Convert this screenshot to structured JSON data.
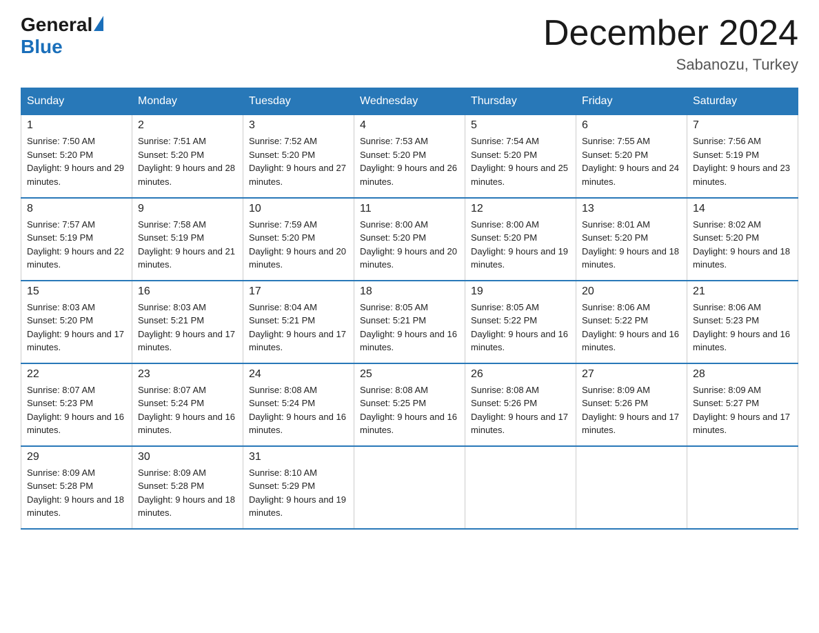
{
  "header": {
    "logo_general": "General",
    "logo_blue": "Blue",
    "title": "December 2024",
    "subtitle": "Sabanozu, Turkey"
  },
  "days_of_week": [
    "Sunday",
    "Monday",
    "Tuesday",
    "Wednesday",
    "Thursday",
    "Friday",
    "Saturday"
  ],
  "weeks": [
    [
      {
        "day": "1",
        "sunrise": "7:50 AM",
        "sunset": "5:20 PM",
        "daylight": "9 hours and 29 minutes."
      },
      {
        "day": "2",
        "sunrise": "7:51 AM",
        "sunset": "5:20 PM",
        "daylight": "9 hours and 28 minutes."
      },
      {
        "day": "3",
        "sunrise": "7:52 AM",
        "sunset": "5:20 PM",
        "daylight": "9 hours and 27 minutes."
      },
      {
        "day": "4",
        "sunrise": "7:53 AM",
        "sunset": "5:20 PM",
        "daylight": "9 hours and 26 minutes."
      },
      {
        "day": "5",
        "sunrise": "7:54 AM",
        "sunset": "5:20 PM",
        "daylight": "9 hours and 25 minutes."
      },
      {
        "day": "6",
        "sunrise": "7:55 AM",
        "sunset": "5:20 PM",
        "daylight": "9 hours and 24 minutes."
      },
      {
        "day": "7",
        "sunrise": "7:56 AM",
        "sunset": "5:19 PM",
        "daylight": "9 hours and 23 minutes."
      }
    ],
    [
      {
        "day": "8",
        "sunrise": "7:57 AM",
        "sunset": "5:19 PM",
        "daylight": "9 hours and 22 minutes."
      },
      {
        "day": "9",
        "sunrise": "7:58 AM",
        "sunset": "5:19 PM",
        "daylight": "9 hours and 21 minutes."
      },
      {
        "day": "10",
        "sunrise": "7:59 AM",
        "sunset": "5:20 PM",
        "daylight": "9 hours and 20 minutes."
      },
      {
        "day": "11",
        "sunrise": "8:00 AM",
        "sunset": "5:20 PM",
        "daylight": "9 hours and 20 minutes."
      },
      {
        "day": "12",
        "sunrise": "8:00 AM",
        "sunset": "5:20 PM",
        "daylight": "9 hours and 19 minutes."
      },
      {
        "day": "13",
        "sunrise": "8:01 AM",
        "sunset": "5:20 PM",
        "daylight": "9 hours and 18 minutes."
      },
      {
        "day": "14",
        "sunrise": "8:02 AM",
        "sunset": "5:20 PM",
        "daylight": "9 hours and 18 minutes."
      }
    ],
    [
      {
        "day": "15",
        "sunrise": "8:03 AM",
        "sunset": "5:20 PM",
        "daylight": "9 hours and 17 minutes."
      },
      {
        "day": "16",
        "sunrise": "8:03 AM",
        "sunset": "5:21 PM",
        "daylight": "9 hours and 17 minutes."
      },
      {
        "day": "17",
        "sunrise": "8:04 AM",
        "sunset": "5:21 PM",
        "daylight": "9 hours and 17 minutes."
      },
      {
        "day": "18",
        "sunrise": "8:05 AM",
        "sunset": "5:21 PM",
        "daylight": "9 hours and 16 minutes."
      },
      {
        "day": "19",
        "sunrise": "8:05 AM",
        "sunset": "5:22 PM",
        "daylight": "9 hours and 16 minutes."
      },
      {
        "day": "20",
        "sunrise": "8:06 AM",
        "sunset": "5:22 PM",
        "daylight": "9 hours and 16 minutes."
      },
      {
        "day": "21",
        "sunrise": "8:06 AM",
        "sunset": "5:23 PM",
        "daylight": "9 hours and 16 minutes."
      }
    ],
    [
      {
        "day": "22",
        "sunrise": "8:07 AM",
        "sunset": "5:23 PM",
        "daylight": "9 hours and 16 minutes."
      },
      {
        "day": "23",
        "sunrise": "8:07 AM",
        "sunset": "5:24 PM",
        "daylight": "9 hours and 16 minutes."
      },
      {
        "day": "24",
        "sunrise": "8:08 AM",
        "sunset": "5:24 PM",
        "daylight": "9 hours and 16 minutes."
      },
      {
        "day": "25",
        "sunrise": "8:08 AM",
        "sunset": "5:25 PM",
        "daylight": "9 hours and 16 minutes."
      },
      {
        "day": "26",
        "sunrise": "8:08 AM",
        "sunset": "5:26 PM",
        "daylight": "9 hours and 17 minutes."
      },
      {
        "day": "27",
        "sunrise": "8:09 AM",
        "sunset": "5:26 PM",
        "daylight": "9 hours and 17 minutes."
      },
      {
        "day": "28",
        "sunrise": "8:09 AM",
        "sunset": "5:27 PM",
        "daylight": "9 hours and 17 minutes."
      }
    ],
    [
      {
        "day": "29",
        "sunrise": "8:09 AM",
        "sunset": "5:28 PM",
        "daylight": "9 hours and 18 minutes."
      },
      {
        "day": "30",
        "sunrise": "8:09 AM",
        "sunset": "5:28 PM",
        "daylight": "9 hours and 18 minutes."
      },
      {
        "day": "31",
        "sunrise": "8:10 AM",
        "sunset": "5:29 PM",
        "daylight": "9 hours and 19 minutes."
      },
      null,
      null,
      null,
      null
    ]
  ]
}
